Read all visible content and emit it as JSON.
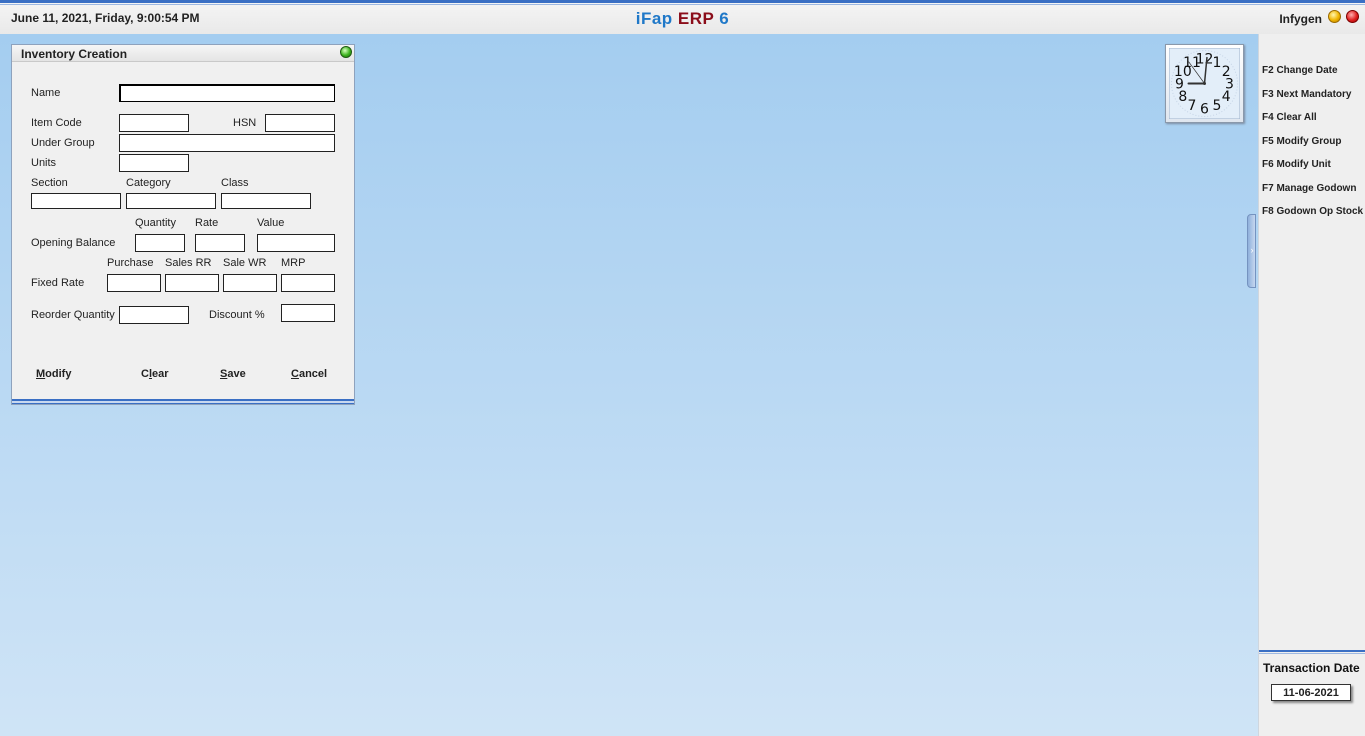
{
  "header": {
    "datetime": "June  11, 2021, Friday, 9:00:54 PM",
    "app_title_part1": "iFap",
    "app_title_part2": "ERP",
    "app_title_part3": "6",
    "company": "Infygen"
  },
  "clock": {
    "numerals": [
      "12",
      "1",
      "2",
      "3",
      "4",
      "5",
      "6",
      "7",
      "8",
      "9",
      "10",
      "11"
    ],
    "hour": 9,
    "minute": 0,
    "second": 54
  },
  "right_panel": {
    "function_keys": [
      "F2 Change Date",
      "F3 Next Mandatory",
      "F4 Clear All",
      "F5 Modify Group",
      "F6 Modify Unit",
      "F7 Manage Godown",
      "F8 Godown Op Stock"
    ],
    "transaction_date_label": "Transaction Date",
    "transaction_date_value": "11-06-2021"
  },
  "inventory_form": {
    "title": "Inventory Creation",
    "labels": {
      "name": "Name",
      "item_code": "Item Code",
      "hsn": "HSN",
      "under_group": "Under Group",
      "units": "Units",
      "section": "Section",
      "category": "Category",
      "class": "Class",
      "quantity": "Quantity",
      "rate": "Rate",
      "value": "Value",
      "opening_balance": "Opening Balance",
      "purchase": "Purchase",
      "sales_rr": "Sales RR",
      "sale_wr": "Sale WR",
      "mrp": "MRP",
      "fixed_rate": "Fixed Rate",
      "reorder_quantity": "Reorder Quantity",
      "discount": "Discount %"
    },
    "values": {
      "name": "",
      "item_code": "",
      "hsn": "",
      "under_group": "",
      "units": "",
      "section": "",
      "category": "",
      "class": "",
      "ob_quantity": "",
      "ob_rate": "",
      "ob_value": "",
      "fr_purchase": "",
      "fr_sales_rr": "",
      "fr_sale_wr": "",
      "fr_mrp": "",
      "reorder_quantity": "",
      "discount": ""
    },
    "buttons": {
      "modify_key": "M",
      "modify_rest": "odify",
      "clear_pre": "C",
      "clear_key": "l",
      "clear_rest": "ear",
      "save_key": "S",
      "save_rest": "ave",
      "cancel_key": "C",
      "cancel_rest": "ancel"
    }
  },
  "colors": {
    "accent_blue": "#1f78c8",
    "brand_red": "#8b0d1a",
    "desktop_top": "#a4cdf0",
    "desktop_bottom": "#cfe4f6"
  }
}
